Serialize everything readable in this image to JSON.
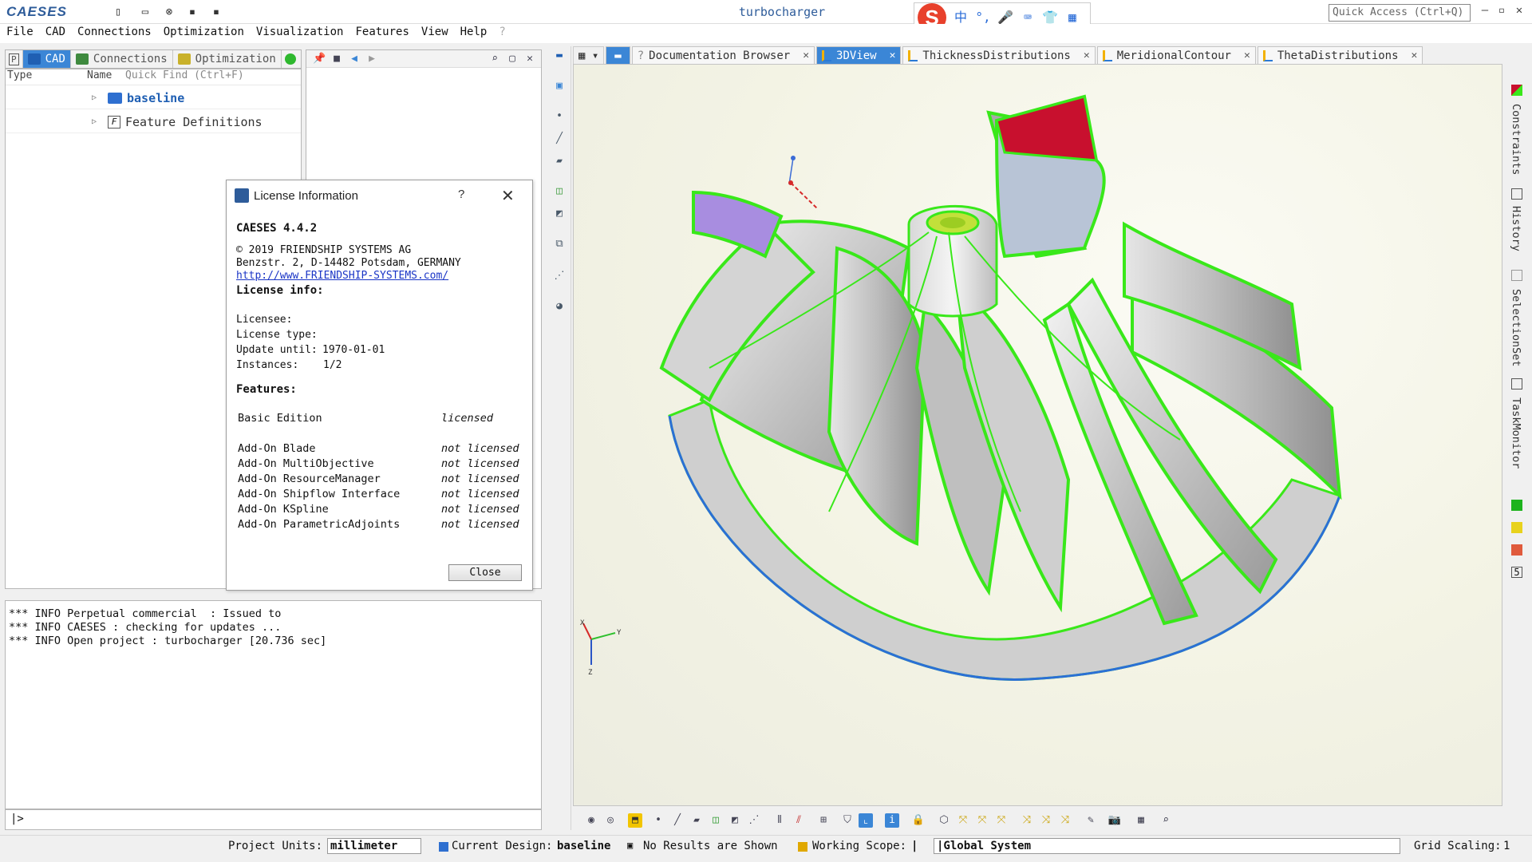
{
  "app": {
    "logo_text": "CAESES",
    "window_title": "turbocharger",
    "quick_access_placeholder": "Quick Access (Ctrl+Q)"
  },
  "menu": [
    "File",
    "CAD",
    "Connections",
    "Optimization",
    "Visualization",
    "Features",
    "View",
    "Help"
  ],
  "left_tabs": [
    {
      "label": "CAD",
      "active": true
    },
    {
      "label": "Connections",
      "active": false
    },
    {
      "label": "Optimization",
      "active": false
    }
  ],
  "tree": {
    "header_type": "Type",
    "header_name": "Name",
    "quick_find_placeholder": "Quick Find (Ctrl+F)",
    "items": [
      {
        "label": "baseline",
        "icon": "folder-icon"
      },
      {
        "label": "Feature Definitions",
        "icon": "feature-icon"
      }
    ]
  },
  "console": {
    "lines": [
      "*** INFO Perpetual commercial  : Issued to",
      "*** INFO CAESES : checking for updates ...",
      "*** INFO Open project : turbocharger [20.736 sec]"
    ],
    "prompt": "|>"
  },
  "view_tabs": [
    {
      "label": "Documentation Browser",
      "active": false
    },
    {
      "label": "3DView",
      "active": true
    },
    {
      "label": "ThicknessDistributions",
      "active": false
    },
    {
      "label": "MeridionalContour",
      "active": false
    },
    {
      "label": "ThetaDistributions",
      "active": false
    }
  ],
  "right_dock": [
    "Constraints",
    "History",
    "SelectionSet",
    "TaskMonitor"
  ],
  "right_dock_swatches": [
    "#1db31d",
    "#e8d21c",
    "#e05a3c"
  ],
  "right_dock_number": "5",
  "axes": {
    "x": "X",
    "y": "Y",
    "z": "Z"
  },
  "status": {
    "project_units_label": "Project Units:",
    "project_units_value": "millimeter",
    "current_design_label": "Current Design:",
    "current_design_value": "baseline",
    "results_text": "No Results are Shown",
    "working_scope_label": "Working Scope:",
    "coordinate_system": "|Global System",
    "grid_scaling_label": "Grid Scaling:",
    "grid_scaling_value": "1"
  },
  "dialog": {
    "title": "License Information",
    "help": "?",
    "product": "CAESES 4.4.2",
    "copyright": "© 2019 FRIENDSHIP SYSTEMS AG",
    "address": "Benzstr. 2, D-14482 Potsdam, GERMANY",
    "url": "http://www.FRIENDSHIP-SYSTEMS.com/",
    "license_info_heading": "License info:",
    "licensee": "Licensee:",
    "license_type": "License type:",
    "update_until_label": "Update until:",
    "update_until_value": "1970-01-01",
    "instances_label": "Instances:",
    "instances_value": "1/2",
    "features_heading": "Features:",
    "features": [
      {
        "name": "Basic Edition",
        "status": "licensed"
      },
      {
        "name": "Add-On Blade",
        "status": "not licensed"
      },
      {
        "name": "Add-On MultiObjective",
        "status": "not licensed"
      },
      {
        "name": "Add-On ResourceManager",
        "status": "not licensed"
      },
      {
        "name": "Add-On Shipflow Interface",
        "status": "not licensed"
      },
      {
        "name": "Add-On KSpline",
        "status": "not licensed"
      },
      {
        "name": "Add-On ParametricAdjoints",
        "status": "not licensed"
      }
    ],
    "close_label": "Close"
  },
  "colors": {
    "accent": "#3b86d6",
    "blade_edge": "#39e81a",
    "blade_face": "#cfcfcf",
    "inlet_red": "#c8102e",
    "inlet_purple": "#a88de0",
    "title_blue": "#2e5c9a"
  }
}
